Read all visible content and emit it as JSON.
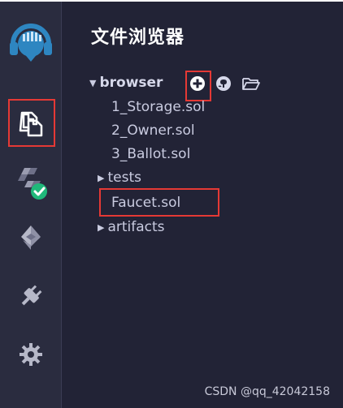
{
  "panel": {
    "title": "文件浏览器"
  },
  "rail": {
    "icons": [
      "remix-logo-icon",
      "file-explorer-icon",
      "solidity-compiler-icon",
      "deploy-run-icon",
      "plugin-manager-icon",
      "settings-icon"
    ]
  },
  "tree": {
    "root_label": "browser",
    "files": [
      "1_Storage.sol",
      "2_Owner.sol",
      "3_Ballot.sol"
    ],
    "folder_tests": "tests",
    "file_faucet": "Faucet.sol",
    "folder_artifacts": "artifacts"
  },
  "toolbar": {
    "icons": [
      "create-file-icon",
      "github-icon",
      "open-folder-icon"
    ]
  },
  "watermark": "CSDN @qq_42042158",
  "colors": {
    "background": "#222336",
    "rail": "#2a2c3f",
    "accent_blue": "#2e86c1",
    "check_green": "#1fb87a",
    "highlight_red": "#e53935"
  }
}
